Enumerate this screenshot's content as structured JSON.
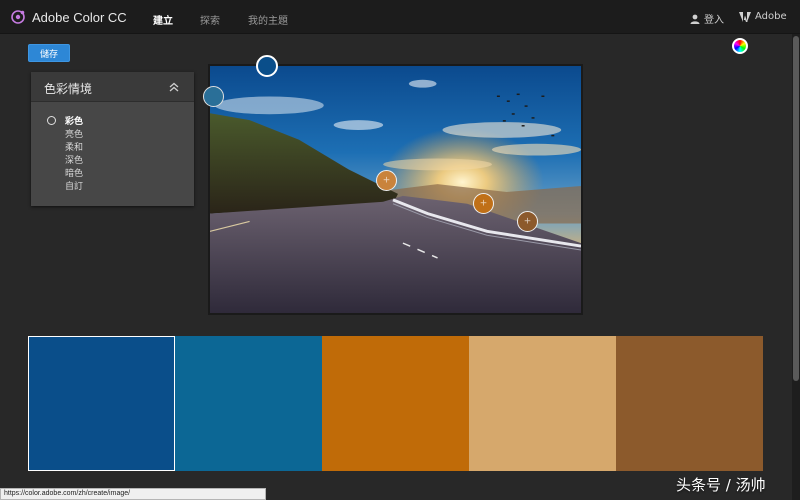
{
  "app": {
    "title": "Adobe Color CC",
    "logo_icon": "adobe-color-logo-icon"
  },
  "nav": {
    "items": [
      {
        "label": "建立",
        "active": true
      },
      {
        "label": "探索",
        "active": false
      },
      {
        "label": "我的主題",
        "active": false
      }
    ]
  },
  "header_right": {
    "login_label": "登入",
    "adobe_label": "Adobe"
  },
  "toolbar": {
    "save_label": "儲存"
  },
  "mood_panel": {
    "title": "色彩情境",
    "options": [
      {
        "label": "彩色",
        "selected": true
      },
      {
        "label": "亮色",
        "selected": false
      },
      {
        "label": "柔和",
        "selected": false
      },
      {
        "label": "深色",
        "selected": false
      },
      {
        "label": "暗色",
        "selected": false
      },
      {
        "label": "自訂",
        "selected": false
      }
    ]
  },
  "palette": {
    "swatches": [
      {
        "color": "#0a4e8a",
        "active": true
      },
      {
        "color": "#0c6795",
        "active": false
      },
      {
        "color": "#c06b08",
        "active": false
      },
      {
        "color": "#d6a86c",
        "active": false
      },
      {
        "color": "#8c5a2c",
        "active": false
      }
    ]
  },
  "status_bar": {
    "url": "https://color.adobe.com/zh/create/image/"
  },
  "watermark": {
    "text": "头条号 / 汤帅"
  }
}
